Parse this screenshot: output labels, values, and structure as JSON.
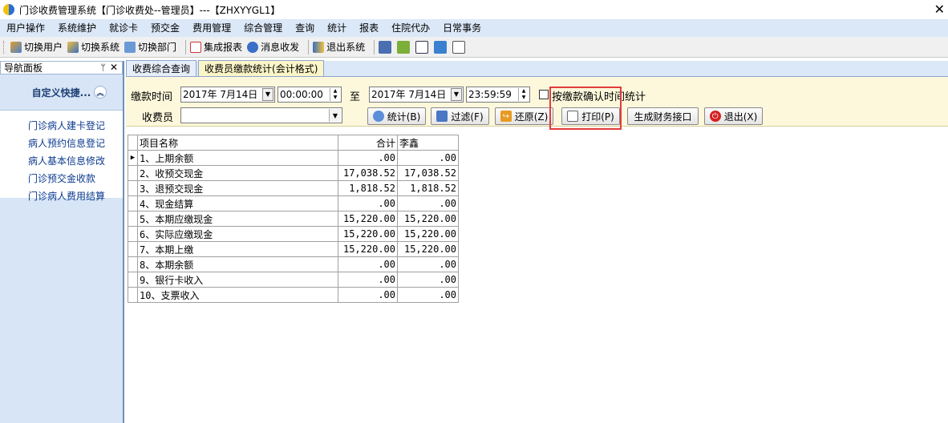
{
  "window": {
    "title": "门诊收费管理系统【门诊收费处--管理员】---【ZHXYYGL1】",
    "close_glyph": "✕"
  },
  "menu": [
    "用户操作",
    "系统维护",
    "就诊卡",
    "预交金",
    "费用管理",
    "综合管理",
    "查询",
    "统计",
    "报表",
    "住院代办",
    "日常事务"
  ],
  "toolbar": {
    "switch_user": "切换用户",
    "switch_system": "切换系统",
    "switch_dept": "切换部门",
    "integrated_report": "集成报表",
    "message": "消息收发",
    "exit_system": "退出系统"
  },
  "nav": {
    "header": "导航面板",
    "pin": "ᛘ",
    "close": "✕",
    "group": "自定义快捷...",
    "items": [
      "门诊病人建卡登记",
      "病人预约信息登记",
      "病人基本信息修改",
      "门诊预交金收款",
      "门诊病人费用结算"
    ]
  },
  "tabs": [
    "收费综合查询",
    "收费员缴款统计(会计格式)"
  ],
  "filter": {
    "time_label": "缴款时间",
    "start_date": "2017年 7月14日",
    "start_time": "00:00:00",
    "to_label": "至",
    "end_date": "2017年 7月14日",
    "end_time": "23:59:59",
    "confirm_label": "按缴款确认时间统计",
    "cashier_label": "收费员",
    "cashier_value": ""
  },
  "buttons": {
    "stat": "统计(B)",
    "filter": "过滤(F)",
    "restore": "还原(Z)",
    "print": "打印(P)",
    "finance": "生成财务接口",
    "exit": "退出(X)"
  },
  "table": {
    "headers": [
      "项目名称",
      "合计",
      "李鑫"
    ],
    "rows": [
      [
        "1、上期余额",
        ".00",
        ".00"
      ],
      [
        "2、收预交现金",
        "17,038.52",
        "17,038.52"
      ],
      [
        "3、退预交现金",
        "1,818.52",
        "1,818.52"
      ],
      [
        "4、现金结算",
        ".00",
        ".00"
      ],
      [
        "5、本期应缴现金",
        "15,220.00",
        "15,220.00"
      ],
      [
        "6、实际应缴现金",
        "15,220.00",
        "15,220.00"
      ],
      [
        "7、本期上缴",
        "15,220.00",
        "15,220.00"
      ],
      [
        "8、本期余额",
        ".00",
        ".00"
      ],
      [
        "9、银行卡收入",
        ".00",
        ".00"
      ],
      [
        "10、支票收入",
        ".00",
        ".00"
      ]
    ]
  },
  "colors": {
    "menu_bg": "#dbe8f8",
    "nav_bg": "#d7e5f6",
    "filter_bg": "#fdf8dc",
    "highlight": "#e23b3b"
  }
}
